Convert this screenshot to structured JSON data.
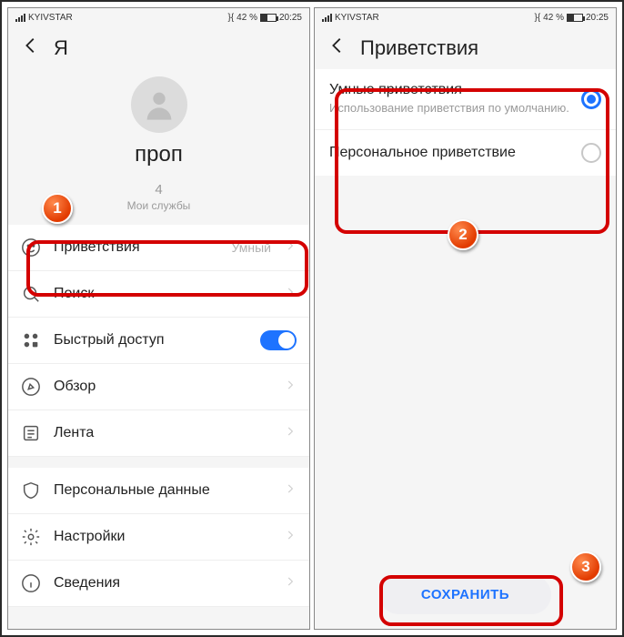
{
  "status": {
    "carrier": "KYIVSTAR",
    "battery_pct": "42 %",
    "time": "20:25",
    "vibrate_icon": "}{"
  },
  "left": {
    "header_title": "Я",
    "profile": {
      "name": "проп",
      "count": "4",
      "sub": "Мои службы"
    },
    "rows": {
      "greet": {
        "label": "Приветствия",
        "value": "Умный"
      },
      "search": {
        "label": "Поиск"
      },
      "quick": {
        "label": "Быстрый доступ"
      },
      "browse": {
        "label": "Обзор"
      },
      "feed": {
        "label": "Лента"
      },
      "personal": {
        "label": "Персональные данные"
      },
      "settings": {
        "label": "Настройки"
      },
      "about": {
        "label": "Сведения"
      }
    }
  },
  "right": {
    "header_title": "Приветствия",
    "opt1": {
      "title": "Умные приветствия",
      "sub": "Использование приветствия по умолчанию."
    },
    "opt2": {
      "title": "Персональное приветствие"
    },
    "save_label": "СОХРАНИТЬ"
  },
  "badges": {
    "one": "1",
    "two": "2",
    "three": "3"
  }
}
